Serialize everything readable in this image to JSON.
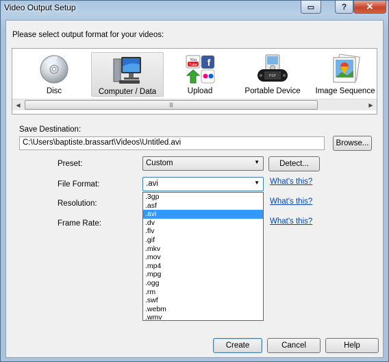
{
  "window": {
    "title": "Video Output Setup",
    "help_glyph": "?",
    "close_glyph": "✕",
    "restore_glyph": "▭"
  },
  "prompt": "Please select output format for your videos:",
  "formats": [
    {
      "label": "Disc",
      "icon": "disc-icon"
    },
    {
      "label": "Computer / Data",
      "icon": "computer-icon",
      "selected": true
    },
    {
      "label": "Upload",
      "icon": "upload-icon"
    },
    {
      "label": "Portable Device",
      "icon": "portable-device-icon"
    },
    {
      "label": "Image Sequence",
      "icon": "image-sequence-icon"
    }
  ],
  "scroll": {
    "left": "◀",
    "right": "▶",
    "grip": "|||"
  },
  "save": {
    "label": "Save Destination:",
    "path": "C:\\Users\\baptiste.brassart\\Videos\\Untitled.avi",
    "browse": "Browse..."
  },
  "preset": {
    "label": "Preset:",
    "value": "Custom",
    "detect": "Detect..."
  },
  "file_format": {
    "label": "File Format:",
    "value": ".avi",
    "whats_this": "What's this?",
    "options": [
      ".3gp",
      ".asf",
      ".avi",
      ".dv",
      ".flv",
      ".gif",
      ".mkv",
      ".mov",
      ".mp4",
      ".mpg",
      ".ogg",
      ".rm",
      ".swf",
      ".webm",
      ".wmv"
    ],
    "selected_option": ".avi"
  },
  "resolution": {
    "label": "Resolution:",
    "whats_this": "What's this?"
  },
  "frame_rate": {
    "label": "Frame Rate:",
    "whats_this": "What's this?"
  },
  "buttons": {
    "create": "Create",
    "cancel": "Cancel",
    "help": "Help"
  },
  "combo_arrow": "▼"
}
